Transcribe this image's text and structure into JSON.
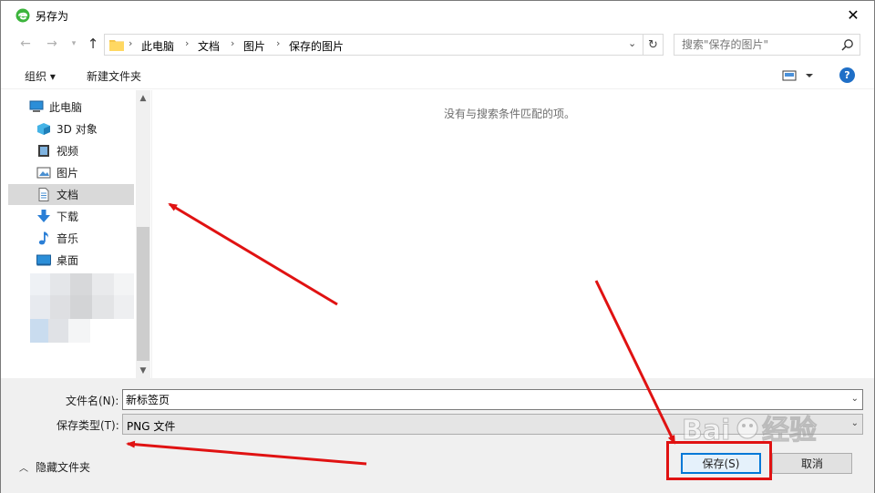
{
  "window": {
    "title": "另存为",
    "close_label": "✕"
  },
  "nav": {
    "breadcrumbs": [
      "此电脑",
      "文档",
      "图片",
      "保存的图片"
    ],
    "search_placeholder": "搜索\"保存的图片\""
  },
  "toolbar": {
    "organize_label": "组织 ▾",
    "new_folder_label": "新建文件夹",
    "help_label": "?"
  },
  "sidebar": {
    "items": [
      {
        "label": "此电脑",
        "icon": "computer-icon"
      },
      {
        "label": "3D 对象",
        "icon": "3d-objects-icon"
      },
      {
        "label": "视频",
        "icon": "video-icon"
      },
      {
        "label": "图片",
        "icon": "pictures-icon"
      },
      {
        "label": "文档",
        "icon": "documents-icon",
        "selected": true
      },
      {
        "label": "下载",
        "icon": "download-icon"
      },
      {
        "label": "音乐",
        "icon": "music-icon"
      },
      {
        "label": "桌面",
        "icon": "desktop-icon"
      }
    ]
  },
  "main": {
    "empty_message": "没有与搜索条件匹配的项。"
  },
  "form": {
    "filename_label": "文件名(N):",
    "filename_value": "新标签页",
    "filetype_label": "保存类型(T):",
    "filetype_value": "PNG 文件",
    "hide_folders_label": "隐藏文件夹",
    "save_label": "保存(S)",
    "cancel_label": "取消"
  },
  "colors": {
    "accent": "#0078d7",
    "annotation_red": "#e01212",
    "selected_bg": "#d9d9d9"
  }
}
